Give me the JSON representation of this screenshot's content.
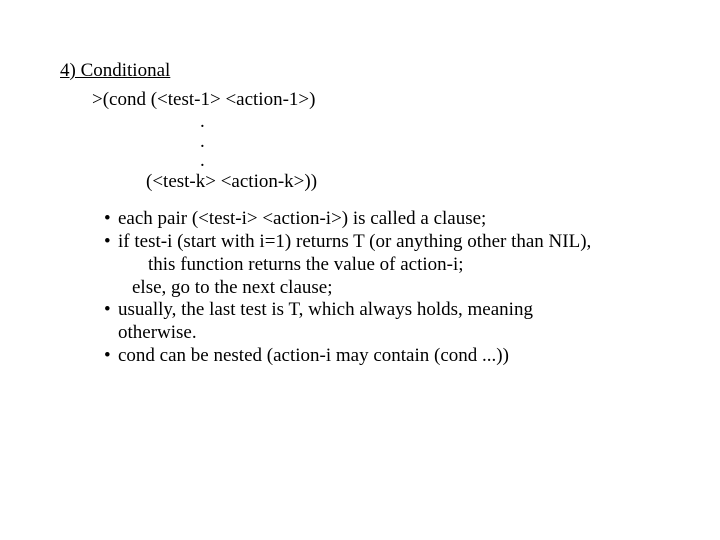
{
  "heading": "4) Conditional",
  "code": {
    "l1": ">(cond (<test-1> <action-1>)",
    "d1": ".",
    "d2": ".",
    "d3": ".",
    "lk": "(<test-k> <action-k>))"
  },
  "bullets": {
    "b1": "each pair (<test-i> <action-i>) is called a clause;",
    "b2a": "if test-i (start with i=1) returns T (or anything other than NIL),",
    "b2b": "this function returns the value of action-i;",
    "b2c": "else, go to the next clause;",
    "b3a": "usually, the last test is T, which always holds, meaning",
    "b3b": "otherwise.",
    "b4": "cond can be nested (action-i may contain (cond ...))"
  },
  "dot": "•"
}
